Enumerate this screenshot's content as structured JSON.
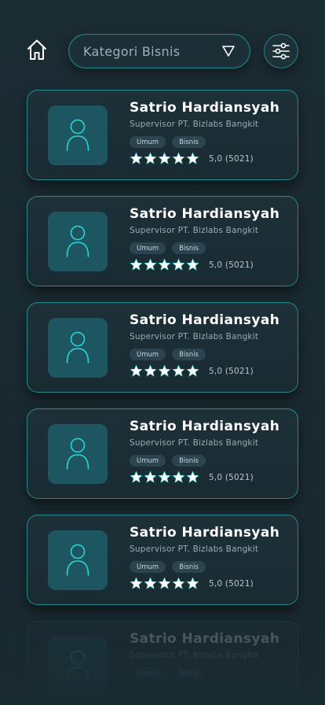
{
  "header": {
    "category_placeholder": "Kategori Bisnis",
    "home_icon": "home-icon",
    "dropdown_icon": "triangle-down-icon",
    "filter_icon": "sliders-icon"
  },
  "colors": {
    "accent": "#28d6d6",
    "background": "#1a2a31",
    "avatar_bg": "#1d5560",
    "star": "#ffffff"
  },
  "cards": [
    {
      "name": "Satrio Hardiansyah",
      "role": "Supervisor PT. Bizlabs Bangkit",
      "tags": [
        "Umum",
        "Bisnis"
      ],
      "stars": 5,
      "rating": "5,0 (5021)"
    },
    {
      "name": "Satrio Hardiansyah",
      "role": "Supervisor PT. Bizlabs Bangkit",
      "tags": [
        "Umum",
        "Bisnis"
      ],
      "stars": 5,
      "rating": "5,0 (5021)"
    },
    {
      "name": "Satrio Hardiansyah",
      "role": "Supervisor PT. Bizlabs Bangkit",
      "tags": [
        "Umum",
        "Bisnis"
      ],
      "stars": 5,
      "rating": "5,0 (5021)"
    },
    {
      "name": "Satrio Hardiansyah",
      "role": "Supervisor PT. Bizlabs Bangkit",
      "tags": [
        "Umum",
        "Bisnis"
      ],
      "stars": 5,
      "rating": "5,0 (5021)"
    },
    {
      "name": "Satrio Hardiansyah",
      "role": "Supervisor PT. Bizlabs Bangkit",
      "tags": [
        "Umum",
        "Bisnis"
      ],
      "stars": 5,
      "rating": "5,0 (5021)"
    },
    {
      "name": "Satrio Hardiansyah",
      "role": "Supervisor PT. Bizlabs Bangkit",
      "tags": [
        "Umum",
        "Bisnis"
      ]
    }
  ]
}
